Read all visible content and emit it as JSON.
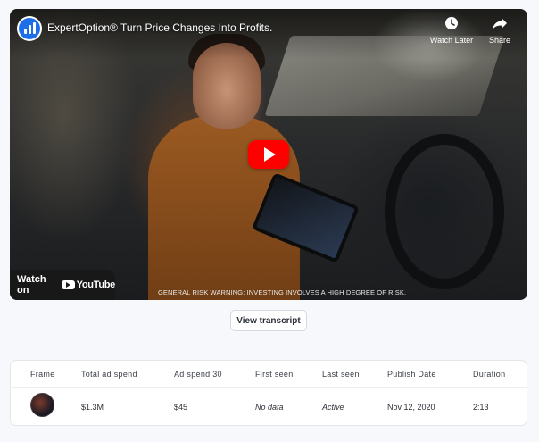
{
  "video": {
    "title": "ExpertOption® Turn Price Changes Into Profits.",
    "watch_later_label": "Watch Later",
    "share_label": "Share",
    "watch_on_label": "Watch on",
    "youtube_label": "YouTube",
    "risk_warning": "GENERAL RISK WARNING: INVESTING INVOLVES A HIGH DEGREE OF RISK."
  },
  "transcript_button": "View transcript",
  "table": {
    "headers": [
      "Frame",
      "Total ad spend",
      "Ad spend 30",
      "First seen",
      "Last seen",
      "Publish Date",
      "Duration"
    ],
    "row": {
      "total_ad_spend": "$1.3M",
      "ad_spend_30": "$45",
      "first_seen": "No data",
      "last_seen": "Active",
      "publish_date": "Nov 12, 2020",
      "duration": "2:13"
    }
  },
  "colors": {
    "play_button": "#ff0000",
    "channel_brand": "#1d6ee8",
    "page_background": "#f7f8fb"
  }
}
